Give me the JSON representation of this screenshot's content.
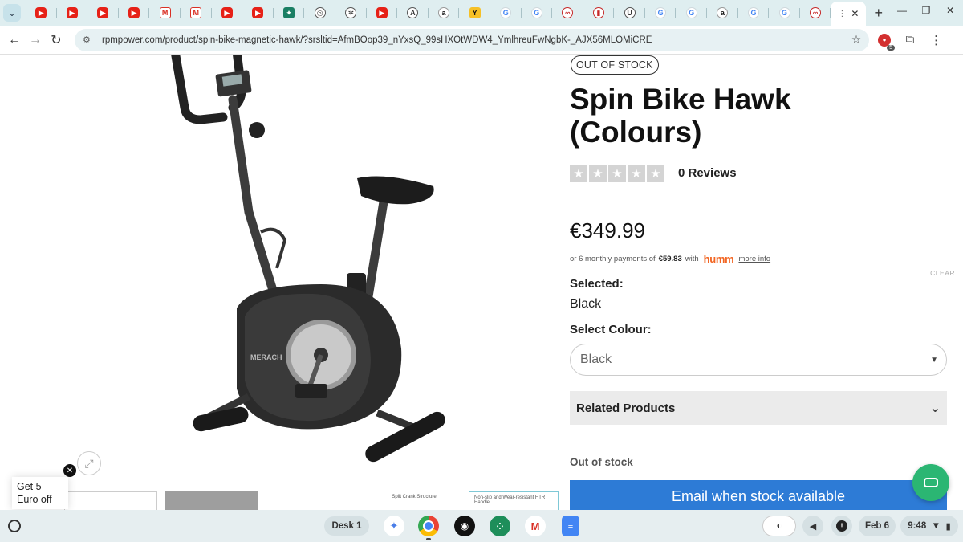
{
  "browser": {
    "tabs": [
      {
        "icon": "youtube-icon",
        "glyph": "▶",
        "kind": "yt"
      },
      {
        "icon": "youtube-icon",
        "glyph": "▶",
        "kind": "yt"
      },
      {
        "icon": "youtube-icon",
        "glyph": "▶",
        "kind": "yt"
      },
      {
        "icon": "youtube-icon",
        "glyph": "▶",
        "kind": "yt"
      },
      {
        "icon": "gmail-icon",
        "glyph": "M",
        "kind": "gm"
      },
      {
        "icon": "gmail-icon",
        "glyph": "M",
        "kind": "gm"
      },
      {
        "icon": "youtube-icon",
        "glyph": "▶",
        "kind": "yt"
      },
      {
        "icon": "youtube-icon",
        "glyph": "▶",
        "kind": "yt"
      },
      {
        "icon": "site-icon",
        "glyph": "✦",
        "kind": "teal"
      },
      {
        "icon": "site-icon",
        "glyph": "◎",
        "kind": "gray"
      },
      {
        "icon": "site-icon",
        "glyph": "✲",
        "kind": "gray"
      },
      {
        "icon": "youtube-icon",
        "glyph": "▶",
        "kind": "yt"
      },
      {
        "icon": "site-icon",
        "glyph": "A",
        "kind": "gray"
      },
      {
        "icon": "amazon-icon",
        "glyph": "a",
        "kind": "amz"
      },
      {
        "icon": "site-icon",
        "glyph": "Y",
        "kind": "yellow"
      },
      {
        "icon": "google-icon",
        "glyph": "G",
        "kind": "g"
      },
      {
        "icon": "google-icon",
        "glyph": "G",
        "kind": "g"
      },
      {
        "icon": "site-icon",
        "glyph": "∞",
        "kind": "red2"
      },
      {
        "icon": "site-icon",
        "glyph": "▮",
        "kind": "red2"
      },
      {
        "icon": "site-icon",
        "glyph": "U",
        "kind": "gray"
      },
      {
        "icon": "google-icon",
        "glyph": "G",
        "kind": "g"
      },
      {
        "icon": "google-icon",
        "glyph": "G",
        "kind": "g"
      },
      {
        "icon": "amazon-icon",
        "glyph": "a",
        "kind": "amz"
      },
      {
        "icon": "google-icon",
        "glyph": "G",
        "kind": "g"
      },
      {
        "icon": "google-icon",
        "glyph": "G",
        "kind": "g"
      },
      {
        "icon": "site-icon",
        "glyph": "∞",
        "kind": "red2"
      }
    ],
    "url": "rpmpower.com/product/spin-bike-magnetic-hawk/?srsltid=AfmBOop39_nYxsQ_99sHXOtWDW4_YmlhreuFwNgbK-_AJX56MLOMiCRE",
    "extension_badge": "5"
  },
  "product": {
    "stock_badge": "OUT OF STOCK",
    "title": "Spin Bike Hawk (Colours)",
    "rating": 0,
    "reviews_label": "0 Reviews",
    "price": "€349.99",
    "finance": {
      "prefix": "or 6 monthly payments of",
      "amount": "€59.83",
      "with": "with",
      "brand": "humm",
      "more_info": "more info"
    },
    "clear_label": "CLEAR",
    "selected_label": "Selected:",
    "selected_value": "Black",
    "colour_label": "Select Colour:",
    "colour_value": "Black",
    "related_label": "Related Products",
    "out_of_stock_label": "Out of stock",
    "email_button": "Email when stock available",
    "brand_logo_text": "MERACH"
  },
  "gallery": {
    "thumb_labels": [
      "",
      "",
      "",
      "Split Crank Structure",
      "Non-slip and Wear-resistant HTR Handle"
    ]
  },
  "promo": {
    "text_line1": "Get 5",
    "text_line2": "Euro off"
  },
  "shelf": {
    "desk_label": "Desk 1",
    "date": "Feb 6",
    "time": "9:48"
  }
}
